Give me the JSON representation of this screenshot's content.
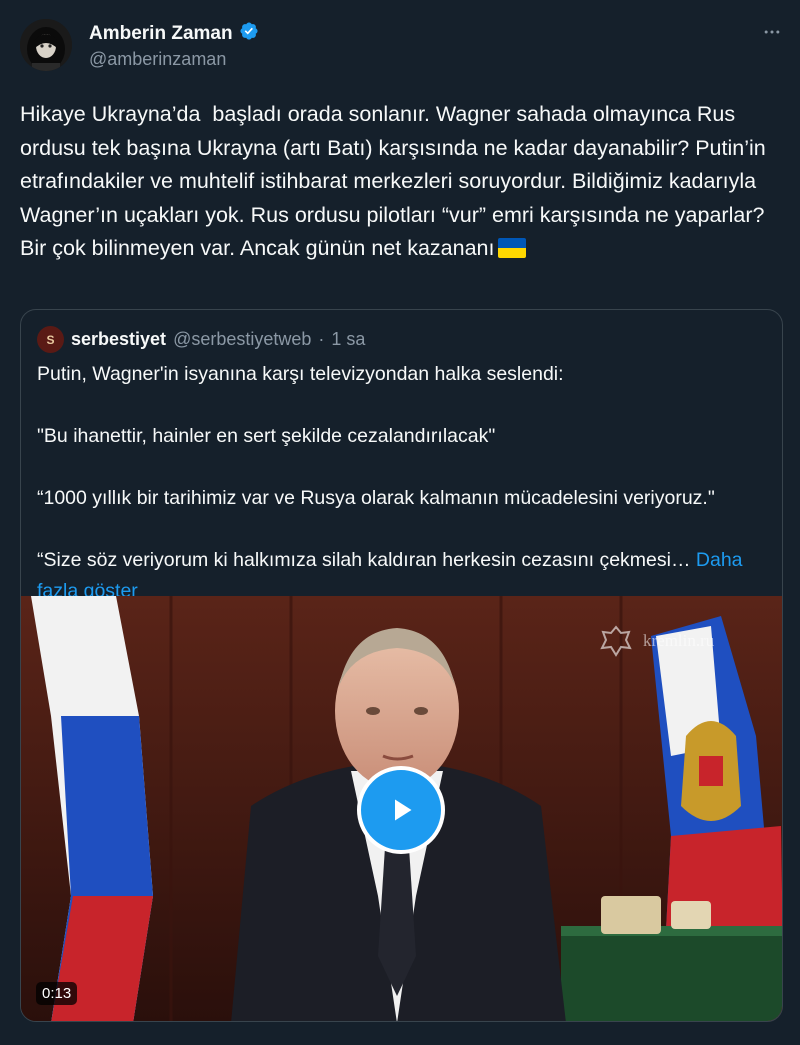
{
  "author": {
    "display_name": "Amberin Zaman",
    "handle": "@amberinzaman"
  },
  "tweet": {
    "text": "Hikaye Ukrayna’da  başladı orada sonlanır. Wagner sahada olmayınca Rus ordusu tek başına Ukrayna (artı Batı) karşısında ne kadar dayanabilir? Putin’in etrafındakiler ve muhtelif istihbarat merkezleri soruyordur. Bildiğimiz kadarıyla  Wagner’ın uçakları yok. Rus ordusu pilotları “vur” emri karşısında ne yaparlar? Bir çok bilinmeyen var. Ancak günün net kazananı",
    "emoji": "ukraine-flag-emoji"
  },
  "quoted": {
    "display_name": "serbestiyet",
    "handle": "@serbestiyetweb",
    "separator": "·",
    "time": "1 sa",
    "paragraphs": [
      "Putin, Wagner'in isyanına karşı televizyondan halka seslendi:",
      "\"Bu ihanettir, hainler en sert şekilde cezalandırılacak\"",
      "“1000 yıllık bir tarihimiz var ve Rusya olarak kalmanın mücadelesini veriyoruz.\"",
      "“Size söz veriyorum ki halkımıza silah kaldıran herkesin cezasını çekmesi…"
    ],
    "show_more": "Daha fazla göster",
    "video": {
      "duration": "0:13",
      "watermark": "kremlin.ru"
    }
  },
  "colors": {
    "background": "#15202b",
    "accent": "#1d9bf0",
    "secondary_text": "#8b98a5",
    "border": "#38444d"
  },
  "icons": [
    "more-options-icon",
    "verified-badge-icon",
    "play-icon",
    "kremlin-emblem-icon"
  ]
}
